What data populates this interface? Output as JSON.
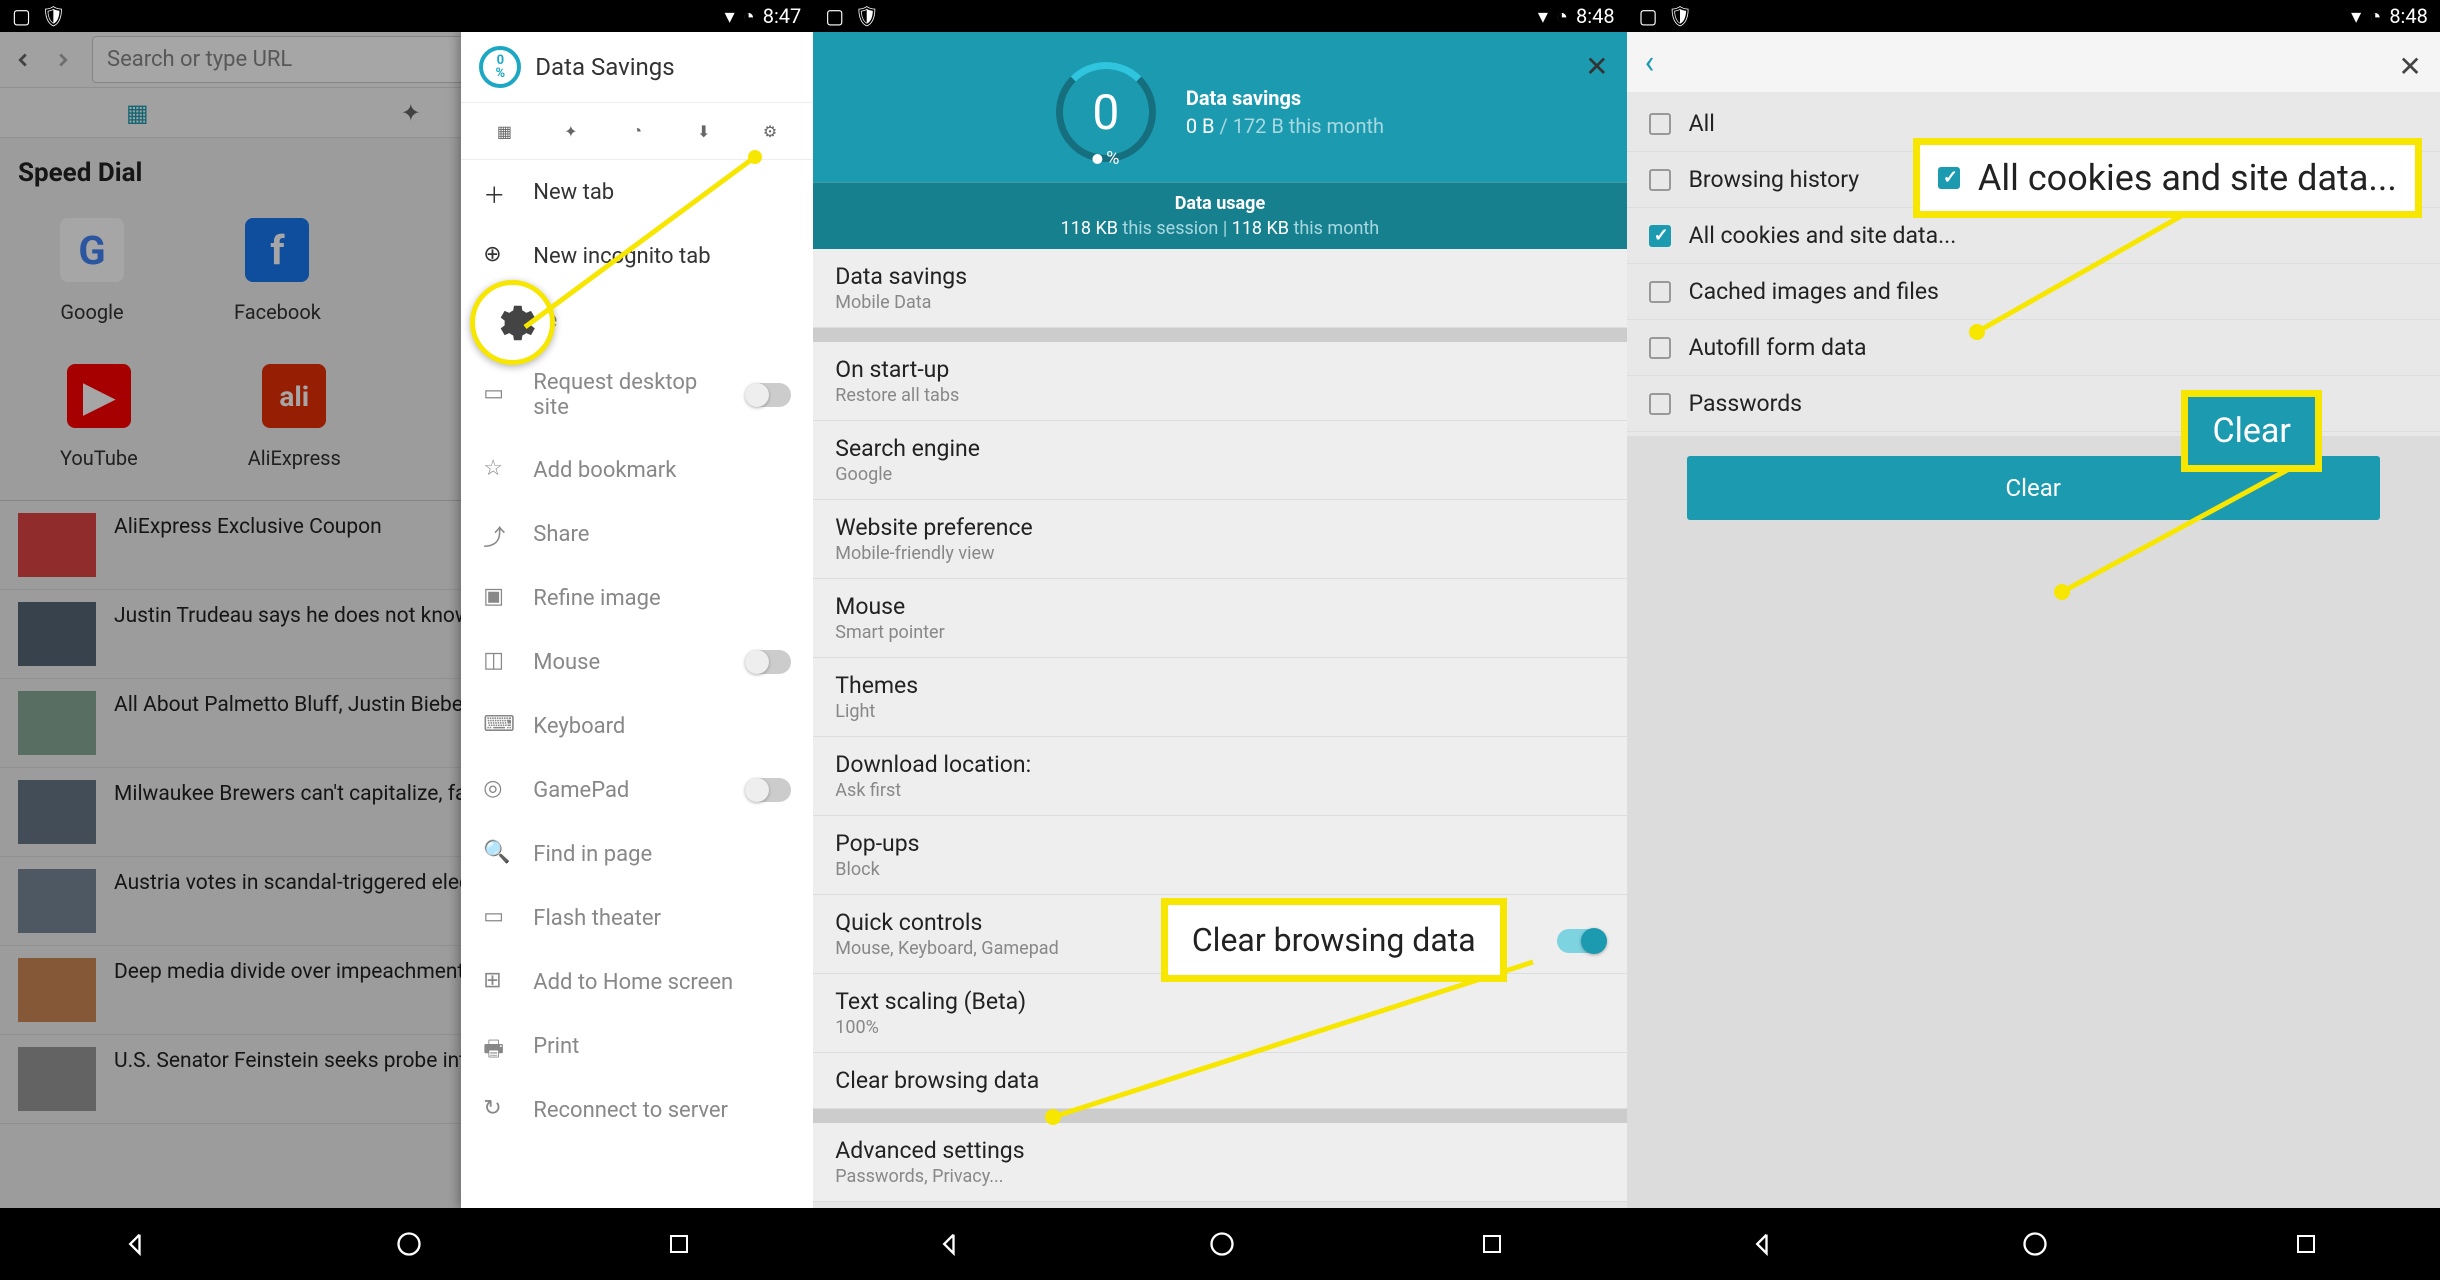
{
  "status": {
    "time1": "8:47",
    "time2": "8:48",
    "time3": "8:48"
  },
  "panel1": {
    "url_placeholder": "Search or type URL",
    "speed_dial_title": "Speed Dial",
    "sd_items": [
      {
        "label": "Google"
      },
      {
        "label": "Facebook"
      }
    ],
    "sd_items2": [
      {
        "label": "YouTube"
      },
      {
        "label": "AliExpress"
      }
    ],
    "news": [
      "AliExpress Exclusive Coupon",
      "Justin Trudeau says he does not know his life",
      "All About Palmetto Bluff, Justin Bieber in South Carolina",
      "Milwaukee Brewers can't capitalize, fall",
      "Austria votes in scandal-triggered elect",
      "Deep media divide over impeachment",
      "U.S. Senator Feinstein seeks probe into EPA actions against California"
    ],
    "drawer": {
      "title": "Data Savings",
      "ring_num": "0",
      "ring_pct": "%",
      "items": [
        {
          "label": "New tab",
          "active": true
        },
        {
          "label": "New incognito tab",
          "active": true
        },
        {
          "label": "ge",
          "active": false,
          "chevron": true
        },
        {
          "label": "Request desktop site",
          "active": false,
          "toggle": true
        },
        {
          "label": "Add bookmark",
          "active": false
        },
        {
          "label": "Share",
          "active": false
        },
        {
          "label": "Refine image",
          "active": false
        },
        {
          "label": "Mouse",
          "active": false,
          "toggle": true
        },
        {
          "label": "Keyboard",
          "active": false
        },
        {
          "label": "GamePad",
          "active": false,
          "toggle": true
        },
        {
          "label": "Find in page",
          "active": false
        },
        {
          "label": "Flash theater",
          "active": false
        },
        {
          "label": "Add to Home screen",
          "active": false
        },
        {
          "label": "Print",
          "active": false
        },
        {
          "label": "Reconnect to server",
          "active": false
        }
      ]
    }
  },
  "panel2": {
    "ring_value": "0",
    "savings_label": "Data savings",
    "savings_line": "0 B",
    "savings_month": " / 172 B this month",
    "usage_title": "Data usage",
    "usage_session": "118 KB",
    "usage_session_label": " this session",
    "usage_sep": " | ",
    "usage_month": "118 KB",
    "usage_month_label": " this month",
    "rows": [
      {
        "title": "Data savings",
        "sub": "Mobile Data"
      },
      {
        "gap": true
      },
      {
        "title": "On start-up",
        "sub": "Restore all tabs"
      },
      {
        "title": "Search engine",
        "sub": "Google"
      },
      {
        "title": "Website preference",
        "sub": "Mobile-friendly view"
      },
      {
        "title": "Mouse",
        "sub": "Smart pointer"
      },
      {
        "title": "Themes",
        "sub": "Light"
      },
      {
        "title": "Download location:",
        "sub": "Ask first"
      },
      {
        "title": "Pop-ups",
        "sub": "Block"
      },
      {
        "title": "Quick controls",
        "sub": "Mouse, Keyboard, Gamepad",
        "toggle_on": true
      },
      {
        "title": "Text scaling (Beta)",
        "sub": "100%"
      },
      {
        "title": "Clear browsing data",
        "sub": ""
      },
      {
        "gap": true
      },
      {
        "title": "Advanced settings",
        "sub": "Passwords, Privacy..."
      }
    ],
    "callout": "Clear browsing data"
  },
  "panel3": {
    "items": [
      {
        "label": "All",
        "checked": false
      },
      {
        "label": "Browsing history",
        "checked": false
      },
      {
        "label": "All cookies and site data...",
        "checked": true
      },
      {
        "label": "Cached images and files",
        "checked": false
      },
      {
        "label": "Autofill form data",
        "checked": false
      },
      {
        "label": "Passwords",
        "checked": false
      }
    ],
    "clear_btn": "Clear",
    "callout_cookies": "All cookies and site data...",
    "callout_clear": "Clear"
  }
}
